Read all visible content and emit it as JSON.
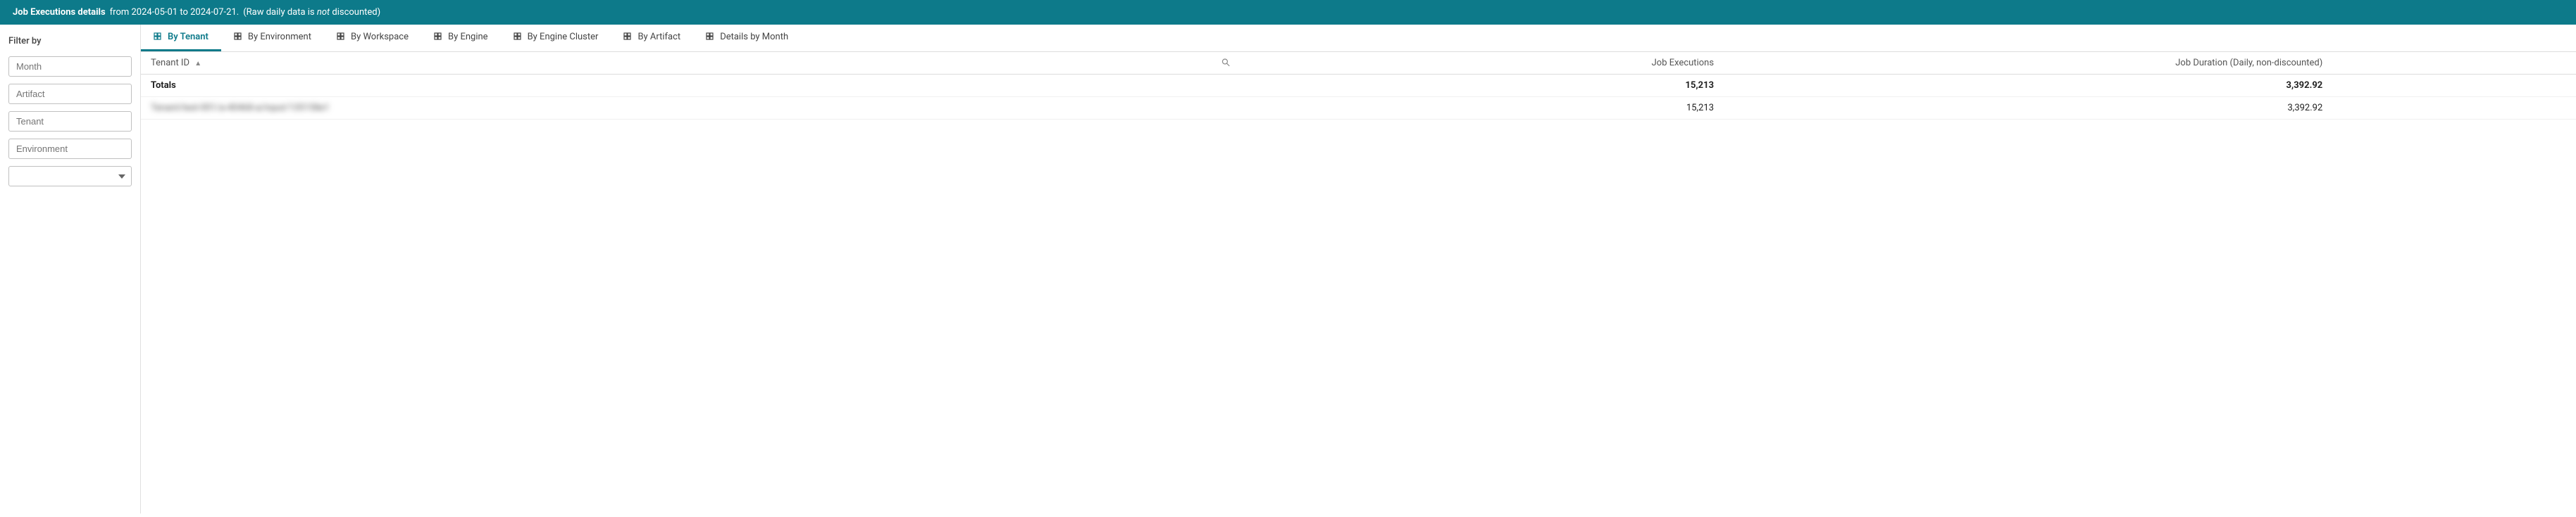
{
  "header": {
    "title_bold": "Job Executions details",
    "subtitle": " from 2024-05-01 to 2024-07-21.",
    "note": "(Raw daily data is ",
    "note_italic": "not",
    "note_end": " discounted)"
  },
  "sidebar": {
    "label": "Filter by",
    "filters": [
      {
        "id": "month",
        "label": "Month",
        "type": "input"
      },
      {
        "id": "artifact",
        "label": "Artifact",
        "type": "input"
      },
      {
        "id": "tenant",
        "label": "Tenant",
        "type": "input"
      },
      {
        "id": "environment",
        "label": "Environment",
        "type": "input"
      },
      {
        "id": "extra",
        "label": "",
        "type": "select"
      }
    ]
  },
  "tabs": [
    {
      "id": "by-tenant",
      "label": "By Tenant",
      "active": true
    },
    {
      "id": "by-environment",
      "label": "By Environment",
      "active": false
    },
    {
      "id": "by-workspace",
      "label": "By Workspace",
      "active": false
    },
    {
      "id": "by-engine",
      "label": "By Engine",
      "active": false
    },
    {
      "id": "by-engine-cluster",
      "label": "By Engine Cluster",
      "active": false
    },
    {
      "id": "by-artifact",
      "label": "By Artifact",
      "active": false
    },
    {
      "id": "details-by-month",
      "label": "Details by Month",
      "active": false
    }
  ],
  "table": {
    "columns": [
      {
        "id": "tenant-id",
        "label": "Tenant ID",
        "sortable": true,
        "searchable": true
      },
      {
        "id": "job-executions",
        "label": "Job Executions",
        "align": "right"
      },
      {
        "id": "job-duration",
        "label": "Job Duration (Daily, non-discounted)",
        "align": "right"
      }
    ],
    "totals_row": {
      "label": "Totals",
      "executions": "15,213",
      "duration": "3,392.92"
    },
    "data_rows": [
      {
        "tenant_id": "██████████████████████████████████████████",
        "executions": "15,213",
        "duration": "3,392.92",
        "blurred": true
      }
    ]
  }
}
